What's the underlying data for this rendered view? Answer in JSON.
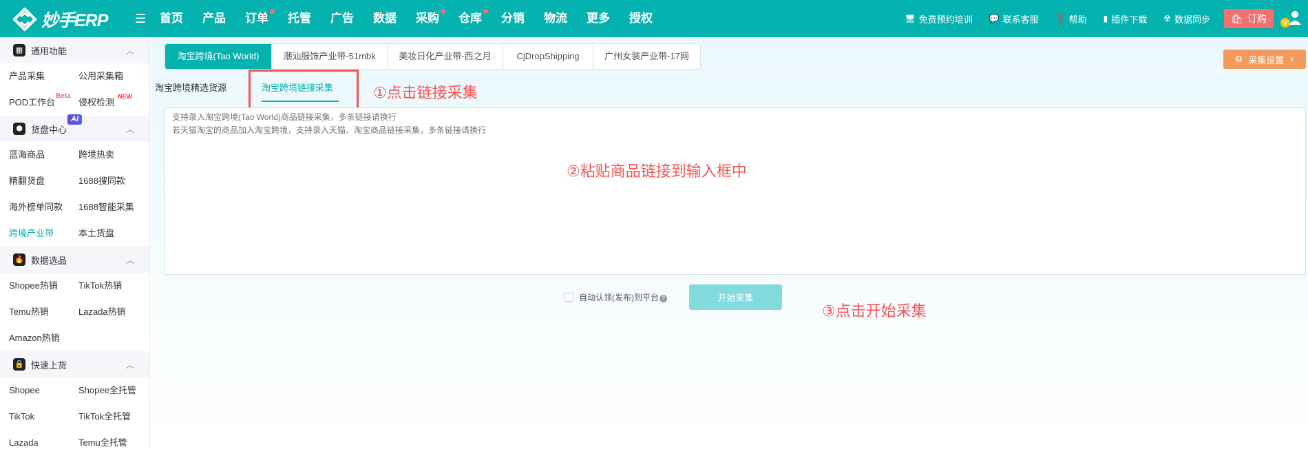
{
  "header": {
    "logo_text": "妙手ERP",
    "nav": [
      {
        "label": "首页",
        "dot": false
      },
      {
        "label": "产品",
        "dot": false
      },
      {
        "label": "订单",
        "dot": true
      },
      {
        "label": "托管",
        "dot": false
      },
      {
        "label": "广告",
        "dot": false
      },
      {
        "label": "数据",
        "dot": false
      },
      {
        "label": "采购",
        "dot": true
      },
      {
        "label": "仓库",
        "dot": true
      },
      {
        "label": "分销",
        "dot": false
      },
      {
        "label": "物流",
        "dot": false
      },
      {
        "label": "更多",
        "dot": false
      },
      {
        "label": "授权",
        "dot": false
      }
    ],
    "right": {
      "training": "免费预约培训",
      "support": "联系客服",
      "help": "帮助",
      "plugin": "插件下载",
      "sync": "数据同步",
      "order": "订购",
      "vip_badge": "V"
    }
  },
  "sidebar": {
    "sections": [
      {
        "title": "通用功能",
        "items": [
          "产品采集",
          "公用采集箱",
          "POD工作台",
          "侵权检测"
        ],
        "badges": {
          "beta": "Beta",
          "new": "NEW"
        }
      },
      {
        "title": "货盘中心",
        "ai_badge": "AI",
        "items": [
          "蓝海商品",
          "跨境热卖",
          "精翻货盘",
          "1688搜同款",
          "海外榜单同款",
          "1688智能采集",
          "跨境产业带",
          "本土货盘"
        ],
        "active": "跨境产业带"
      },
      {
        "title": "数据选品",
        "items": [
          "Shopee热销",
          "TikTok热销",
          "Temu热销",
          "Lazada热销",
          "Amazon热销"
        ]
      },
      {
        "title": "快速上货",
        "items": [
          "Shopee",
          "Shopee全托管",
          "TikTok",
          "TikTok全托管",
          "Lazada",
          "Temu全托管"
        ]
      }
    ]
  },
  "main": {
    "tabs": [
      "淘宝跨境(Tao World)",
      "潮汕服饰产业带-51mbk",
      "美妆日化产业带-西之月",
      "CjDropShipping",
      "广州女装产业带-17网"
    ],
    "settings_button": "采集设置",
    "subtabs": [
      "淘宝跨境精选货源",
      "淘宝跨境链接采集"
    ],
    "textarea_placeholder": "支持录入淘宝跨境(Tao World)商品链接采集，多条链接请换行\n若天猫淘宝的商品加入淘宝跨境，支持录入天猫、淘宝商品链接采集，多条链接请换行",
    "checkbox_label": "自动认领(发布)到平台",
    "start_button": "开始采集",
    "annotations": [
      "①点击链接采集",
      "②粘贴商品链接到输入框中",
      "③点击开始采集"
    ]
  },
  "colors": {
    "brand": "#04b2b0",
    "order": "#f46f6f",
    "settings": "#f29b5c",
    "annotation": "#f35555"
  }
}
